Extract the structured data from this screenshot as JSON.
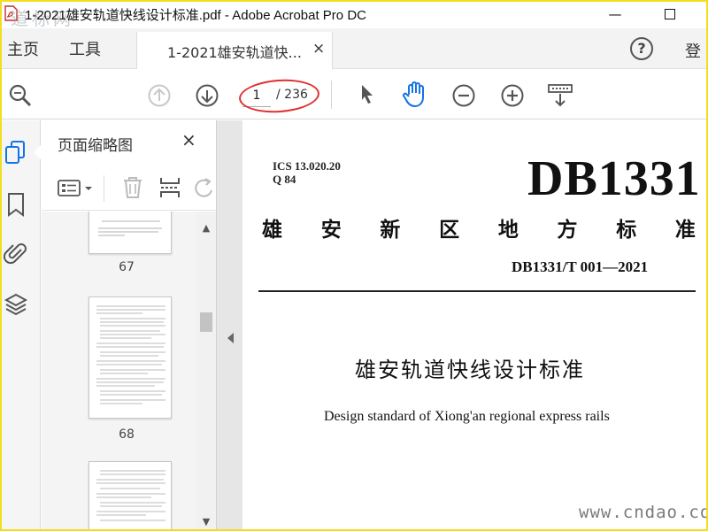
{
  "window": {
    "title": "1-2021雄安轨道快线设计标准.pdf - Adobe Acrobat Pro DC",
    "minimize_label": "—",
    "watermark_text": "道标网"
  },
  "menubar": {
    "home_label": "主页",
    "tools_label": "工具",
    "tab_label": "1-2021雄安轨道快...",
    "tab_close": "×",
    "help_label": "?",
    "login_label": "登"
  },
  "toolbar": {
    "current_page": "1",
    "total_pages": "/ 236",
    "icons": [
      "zoom-icon",
      "page-up-icon",
      "page-down-icon",
      "select-arrow-icon",
      "hand-icon",
      "zoom-out-icon",
      "zoom-in-icon",
      "page-fit-icon"
    ]
  },
  "thumbnails": {
    "panel_title": "页面缩略图",
    "close_label": "×",
    "pages": [
      {
        "number": "67"
      },
      {
        "number": "68"
      },
      {
        "number": ""
      }
    ]
  },
  "document": {
    "ics_line": "ICS  13.020.20",
    "q_line": "Q  84",
    "db_code": "DB1331",
    "region_chars": [
      "雄",
      "安",
      "新",
      "区",
      "地",
      "方",
      "标",
      "准"
    ],
    "standard_code": "DB1331/T 001—2021",
    "title_zh": "雄安轨道快线设计标准",
    "title_en": "Design standard of Xiong'an regional express rails",
    "watermark": "www.cndao.com"
  },
  "colors": {
    "accent_blue": "#1473e6",
    "annotation_red": "#e03030",
    "frame_yellow": "#f2dd1e"
  }
}
